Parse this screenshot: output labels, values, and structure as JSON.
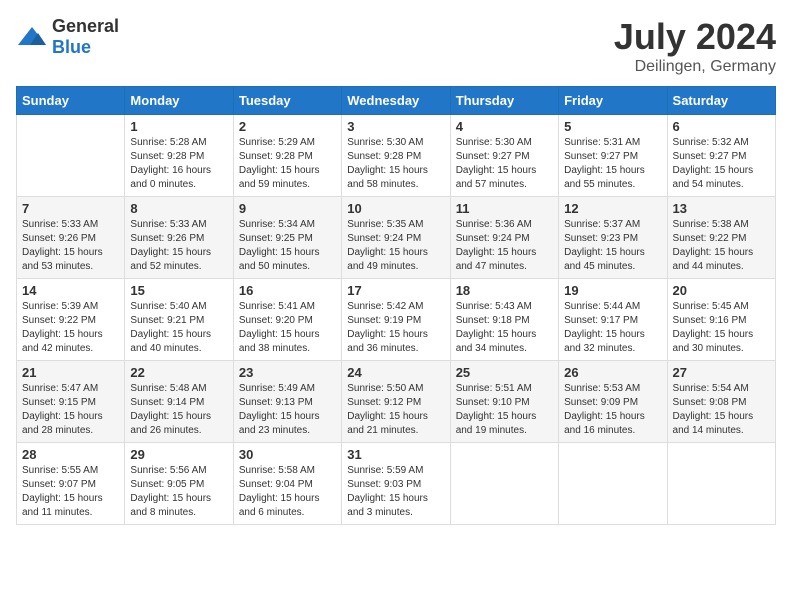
{
  "header": {
    "logo_general": "General",
    "logo_blue": "Blue",
    "month": "July 2024",
    "location": "Deilingen, Germany"
  },
  "columns": [
    "Sunday",
    "Monday",
    "Tuesday",
    "Wednesday",
    "Thursday",
    "Friday",
    "Saturday"
  ],
  "weeks": [
    [
      {
        "day": "",
        "info": ""
      },
      {
        "day": "1",
        "info": "Sunrise: 5:28 AM\nSunset: 9:28 PM\nDaylight: 16 hours\nand 0 minutes."
      },
      {
        "day": "2",
        "info": "Sunrise: 5:29 AM\nSunset: 9:28 PM\nDaylight: 15 hours\nand 59 minutes."
      },
      {
        "day": "3",
        "info": "Sunrise: 5:30 AM\nSunset: 9:28 PM\nDaylight: 15 hours\nand 58 minutes."
      },
      {
        "day": "4",
        "info": "Sunrise: 5:30 AM\nSunset: 9:27 PM\nDaylight: 15 hours\nand 57 minutes."
      },
      {
        "day": "5",
        "info": "Sunrise: 5:31 AM\nSunset: 9:27 PM\nDaylight: 15 hours\nand 55 minutes."
      },
      {
        "day": "6",
        "info": "Sunrise: 5:32 AM\nSunset: 9:27 PM\nDaylight: 15 hours\nand 54 minutes."
      }
    ],
    [
      {
        "day": "7",
        "info": "Sunrise: 5:33 AM\nSunset: 9:26 PM\nDaylight: 15 hours\nand 53 minutes."
      },
      {
        "day": "8",
        "info": "Sunrise: 5:33 AM\nSunset: 9:26 PM\nDaylight: 15 hours\nand 52 minutes."
      },
      {
        "day": "9",
        "info": "Sunrise: 5:34 AM\nSunset: 9:25 PM\nDaylight: 15 hours\nand 50 minutes."
      },
      {
        "day": "10",
        "info": "Sunrise: 5:35 AM\nSunset: 9:24 PM\nDaylight: 15 hours\nand 49 minutes."
      },
      {
        "day": "11",
        "info": "Sunrise: 5:36 AM\nSunset: 9:24 PM\nDaylight: 15 hours\nand 47 minutes."
      },
      {
        "day": "12",
        "info": "Sunrise: 5:37 AM\nSunset: 9:23 PM\nDaylight: 15 hours\nand 45 minutes."
      },
      {
        "day": "13",
        "info": "Sunrise: 5:38 AM\nSunset: 9:22 PM\nDaylight: 15 hours\nand 44 minutes."
      }
    ],
    [
      {
        "day": "14",
        "info": "Sunrise: 5:39 AM\nSunset: 9:22 PM\nDaylight: 15 hours\nand 42 minutes."
      },
      {
        "day": "15",
        "info": "Sunrise: 5:40 AM\nSunset: 9:21 PM\nDaylight: 15 hours\nand 40 minutes."
      },
      {
        "day": "16",
        "info": "Sunrise: 5:41 AM\nSunset: 9:20 PM\nDaylight: 15 hours\nand 38 minutes."
      },
      {
        "day": "17",
        "info": "Sunrise: 5:42 AM\nSunset: 9:19 PM\nDaylight: 15 hours\nand 36 minutes."
      },
      {
        "day": "18",
        "info": "Sunrise: 5:43 AM\nSunset: 9:18 PM\nDaylight: 15 hours\nand 34 minutes."
      },
      {
        "day": "19",
        "info": "Sunrise: 5:44 AM\nSunset: 9:17 PM\nDaylight: 15 hours\nand 32 minutes."
      },
      {
        "day": "20",
        "info": "Sunrise: 5:45 AM\nSunset: 9:16 PM\nDaylight: 15 hours\nand 30 minutes."
      }
    ],
    [
      {
        "day": "21",
        "info": "Sunrise: 5:47 AM\nSunset: 9:15 PM\nDaylight: 15 hours\nand 28 minutes."
      },
      {
        "day": "22",
        "info": "Sunrise: 5:48 AM\nSunset: 9:14 PM\nDaylight: 15 hours\nand 26 minutes."
      },
      {
        "day": "23",
        "info": "Sunrise: 5:49 AM\nSunset: 9:13 PM\nDaylight: 15 hours\nand 23 minutes."
      },
      {
        "day": "24",
        "info": "Sunrise: 5:50 AM\nSunset: 9:12 PM\nDaylight: 15 hours\nand 21 minutes."
      },
      {
        "day": "25",
        "info": "Sunrise: 5:51 AM\nSunset: 9:10 PM\nDaylight: 15 hours\nand 19 minutes."
      },
      {
        "day": "26",
        "info": "Sunrise: 5:53 AM\nSunset: 9:09 PM\nDaylight: 15 hours\nand 16 minutes."
      },
      {
        "day": "27",
        "info": "Sunrise: 5:54 AM\nSunset: 9:08 PM\nDaylight: 15 hours\nand 14 minutes."
      }
    ],
    [
      {
        "day": "28",
        "info": "Sunrise: 5:55 AM\nSunset: 9:07 PM\nDaylight: 15 hours\nand 11 minutes."
      },
      {
        "day": "29",
        "info": "Sunrise: 5:56 AM\nSunset: 9:05 PM\nDaylight: 15 hours\nand 8 minutes."
      },
      {
        "day": "30",
        "info": "Sunrise: 5:58 AM\nSunset: 9:04 PM\nDaylight: 15 hours\nand 6 minutes."
      },
      {
        "day": "31",
        "info": "Sunrise: 5:59 AM\nSunset: 9:03 PM\nDaylight: 15 hours\nand 3 minutes."
      },
      {
        "day": "",
        "info": ""
      },
      {
        "day": "",
        "info": ""
      },
      {
        "day": "",
        "info": ""
      }
    ]
  ]
}
